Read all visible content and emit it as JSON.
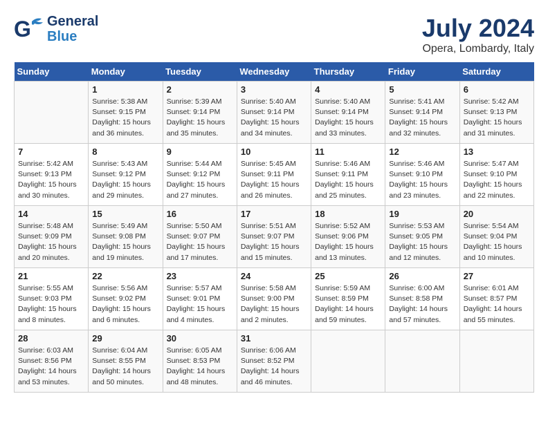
{
  "header": {
    "logo_line1": "General",
    "logo_line2": "Blue",
    "title": "July 2024",
    "subtitle": "Opera, Lombardy, Italy"
  },
  "weekdays": [
    "Sunday",
    "Monday",
    "Tuesday",
    "Wednesday",
    "Thursday",
    "Friday",
    "Saturday"
  ],
  "weeks": [
    [
      {
        "day": "",
        "info": ""
      },
      {
        "day": "1",
        "info": "Sunrise: 5:38 AM\nSunset: 9:15 PM\nDaylight: 15 hours\nand 36 minutes."
      },
      {
        "day": "2",
        "info": "Sunrise: 5:39 AM\nSunset: 9:14 PM\nDaylight: 15 hours\nand 35 minutes."
      },
      {
        "day": "3",
        "info": "Sunrise: 5:40 AM\nSunset: 9:14 PM\nDaylight: 15 hours\nand 34 minutes."
      },
      {
        "day": "4",
        "info": "Sunrise: 5:40 AM\nSunset: 9:14 PM\nDaylight: 15 hours\nand 33 minutes."
      },
      {
        "day": "5",
        "info": "Sunrise: 5:41 AM\nSunset: 9:14 PM\nDaylight: 15 hours\nand 32 minutes."
      },
      {
        "day": "6",
        "info": "Sunrise: 5:42 AM\nSunset: 9:13 PM\nDaylight: 15 hours\nand 31 minutes."
      }
    ],
    [
      {
        "day": "7",
        "info": "Sunrise: 5:42 AM\nSunset: 9:13 PM\nDaylight: 15 hours\nand 30 minutes."
      },
      {
        "day": "8",
        "info": "Sunrise: 5:43 AM\nSunset: 9:12 PM\nDaylight: 15 hours\nand 29 minutes."
      },
      {
        "day": "9",
        "info": "Sunrise: 5:44 AM\nSunset: 9:12 PM\nDaylight: 15 hours\nand 27 minutes."
      },
      {
        "day": "10",
        "info": "Sunrise: 5:45 AM\nSunset: 9:11 PM\nDaylight: 15 hours\nand 26 minutes."
      },
      {
        "day": "11",
        "info": "Sunrise: 5:46 AM\nSunset: 9:11 PM\nDaylight: 15 hours\nand 25 minutes."
      },
      {
        "day": "12",
        "info": "Sunrise: 5:46 AM\nSunset: 9:10 PM\nDaylight: 15 hours\nand 23 minutes."
      },
      {
        "day": "13",
        "info": "Sunrise: 5:47 AM\nSunset: 9:10 PM\nDaylight: 15 hours\nand 22 minutes."
      }
    ],
    [
      {
        "day": "14",
        "info": "Sunrise: 5:48 AM\nSunset: 9:09 PM\nDaylight: 15 hours\nand 20 minutes."
      },
      {
        "day": "15",
        "info": "Sunrise: 5:49 AM\nSunset: 9:08 PM\nDaylight: 15 hours\nand 19 minutes."
      },
      {
        "day": "16",
        "info": "Sunrise: 5:50 AM\nSunset: 9:07 PM\nDaylight: 15 hours\nand 17 minutes."
      },
      {
        "day": "17",
        "info": "Sunrise: 5:51 AM\nSunset: 9:07 PM\nDaylight: 15 hours\nand 15 minutes."
      },
      {
        "day": "18",
        "info": "Sunrise: 5:52 AM\nSunset: 9:06 PM\nDaylight: 15 hours\nand 13 minutes."
      },
      {
        "day": "19",
        "info": "Sunrise: 5:53 AM\nSunset: 9:05 PM\nDaylight: 15 hours\nand 12 minutes."
      },
      {
        "day": "20",
        "info": "Sunrise: 5:54 AM\nSunset: 9:04 PM\nDaylight: 15 hours\nand 10 minutes."
      }
    ],
    [
      {
        "day": "21",
        "info": "Sunrise: 5:55 AM\nSunset: 9:03 PM\nDaylight: 15 hours\nand 8 minutes."
      },
      {
        "day": "22",
        "info": "Sunrise: 5:56 AM\nSunset: 9:02 PM\nDaylight: 15 hours\nand 6 minutes."
      },
      {
        "day": "23",
        "info": "Sunrise: 5:57 AM\nSunset: 9:01 PM\nDaylight: 15 hours\nand 4 minutes."
      },
      {
        "day": "24",
        "info": "Sunrise: 5:58 AM\nSunset: 9:00 PM\nDaylight: 15 hours\nand 2 minutes."
      },
      {
        "day": "25",
        "info": "Sunrise: 5:59 AM\nSunset: 8:59 PM\nDaylight: 14 hours\nand 59 minutes."
      },
      {
        "day": "26",
        "info": "Sunrise: 6:00 AM\nSunset: 8:58 PM\nDaylight: 14 hours\nand 57 minutes."
      },
      {
        "day": "27",
        "info": "Sunrise: 6:01 AM\nSunset: 8:57 PM\nDaylight: 14 hours\nand 55 minutes."
      }
    ],
    [
      {
        "day": "28",
        "info": "Sunrise: 6:03 AM\nSunset: 8:56 PM\nDaylight: 14 hours\nand 53 minutes."
      },
      {
        "day": "29",
        "info": "Sunrise: 6:04 AM\nSunset: 8:55 PM\nDaylight: 14 hours\nand 50 minutes."
      },
      {
        "day": "30",
        "info": "Sunrise: 6:05 AM\nSunset: 8:53 PM\nDaylight: 14 hours\nand 48 minutes."
      },
      {
        "day": "31",
        "info": "Sunrise: 6:06 AM\nSunset: 8:52 PM\nDaylight: 14 hours\nand 46 minutes."
      },
      {
        "day": "",
        "info": ""
      },
      {
        "day": "",
        "info": ""
      },
      {
        "day": "",
        "info": ""
      }
    ]
  ]
}
